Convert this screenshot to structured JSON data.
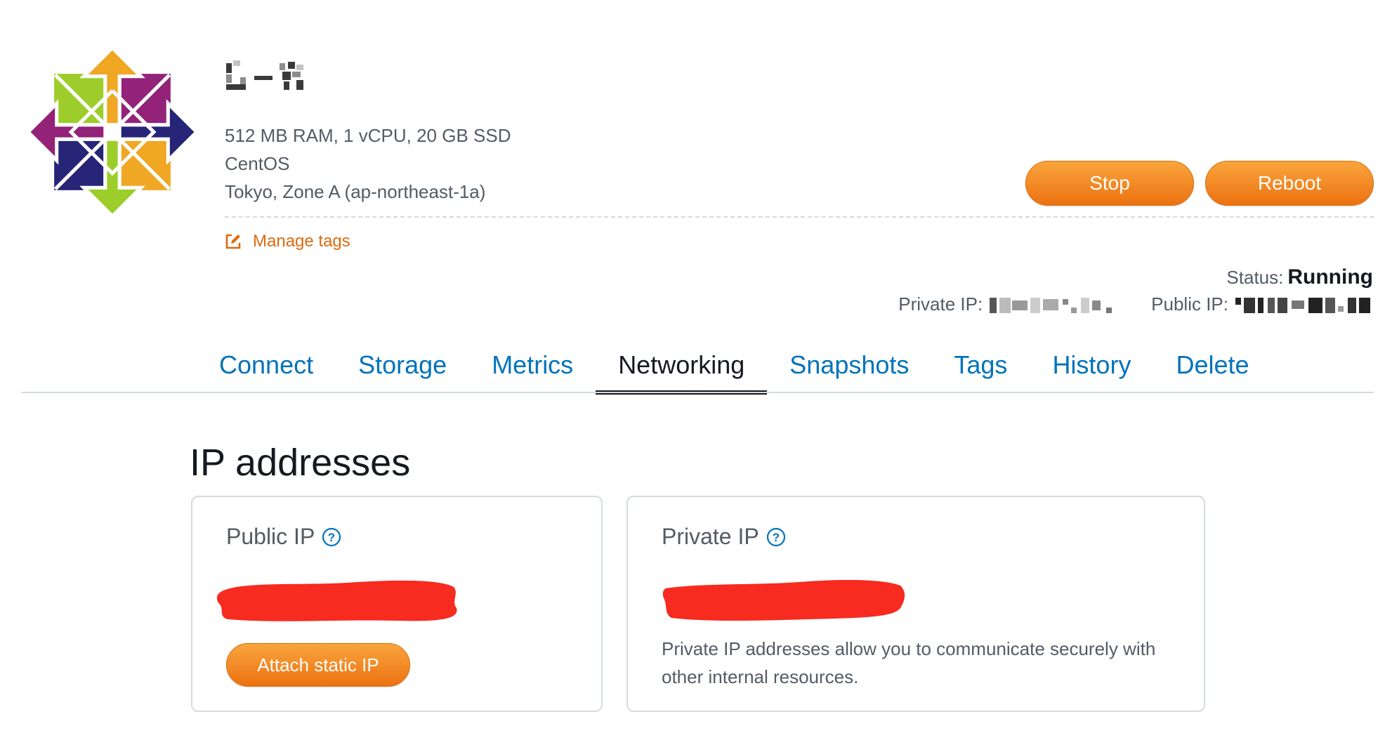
{
  "colors": {
    "accent_orange": "#ec7211",
    "link_blue": "#0073bb",
    "text_dark": "#16191f",
    "text_muted": "#545b64",
    "redaction_red": "#f72b1f"
  },
  "instance": {
    "specs": "512 MB RAM, 1 vCPU, 20 GB SSD",
    "os": "CentOS",
    "zone": "Tokyo, Zone A (ap-northeast-1a)",
    "logo_icon": "centos-logo",
    "name_redacted": true
  },
  "actions": {
    "stop_label": "Stop",
    "reboot_label": "Reboot",
    "manage_tags_label": "Manage tags"
  },
  "status": {
    "label": "Status:",
    "value": "Running",
    "private_ip_label": "Private IP:",
    "public_ip_label": "Public IP:"
  },
  "tabs": [
    {
      "label": "Connect",
      "active": false
    },
    {
      "label": "Storage",
      "active": false
    },
    {
      "label": "Metrics",
      "active": false
    },
    {
      "label": "Networking",
      "active": true
    },
    {
      "label": "Snapshots",
      "active": false
    },
    {
      "label": "Tags",
      "active": false
    },
    {
      "label": "History",
      "active": false
    },
    {
      "label": "Delete",
      "active": false
    }
  ],
  "ip_section": {
    "title": "IP addresses",
    "public": {
      "label": "Public IP",
      "attach_label": "Attach static IP"
    },
    "private": {
      "label": "Private IP",
      "description": "Private IP addresses allow you to communicate securely with other internal resources."
    }
  }
}
